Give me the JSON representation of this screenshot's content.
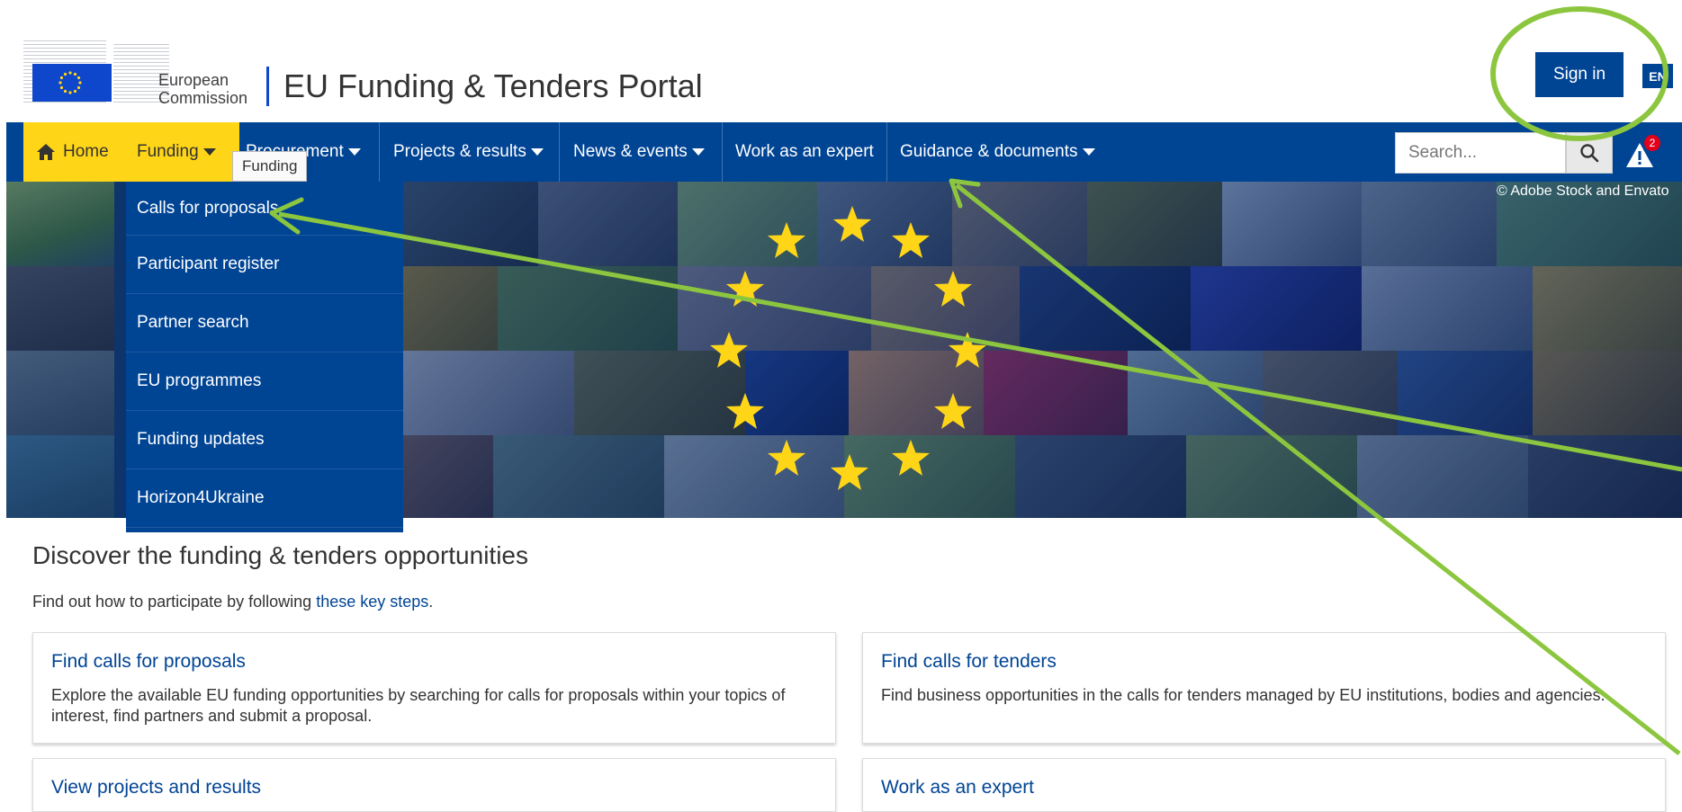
{
  "header": {
    "org_line1": "European",
    "org_line2": "Commission",
    "portal_title": "EU Funding & Tenders Portal",
    "sign_in": "Sign in",
    "language": "EN"
  },
  "nav": {
    "items": [
      {
        "label": "Home"
      },
      {
        "label": "Funding"
      },
      {
        "label": "Procurement"
      },
      {
        "label": "Projects & results"
      },
      {
        "label": "News & events"
      },
      {
        "label": "Work as an expert"
      },
      {
        "label": "Guidance & documents"
      }
    ],
    "search_placeholder": "Search...",
    "alert_count": "2",
    "tooltip": "Funding"
  },
  "dropdown": {
    "items": [
      "Calls for proposals",
      "Participant register",
      "Partner search",
      "EU programmes",
      "Funding updates",
      "Horizon4Ukraine"
    ]
  },
  "hero": {
    "copyright": "© Adobe Stock and Envato"
  },
  "main": {
    "title": "Discover the funding & tenders opportunities",
    "intro_prefix": "Find out how to participate by following ",
    "intro_link": "these key steps",
    "intro_suffix": ".",
    "cards": [
      {
        "title": "Find calls for proposals",
        "desc": "Explore the available EU funding opportunities by searching for calls for proposals within your topics of interest, find partners and submit a proposal."
      },
      {
        "title": "Find calls for tenders",
        "desc": "Find business opportunities in the calls for tenders managed by EU institutions, bodies and agencies."
      },
      {
        "title": "View projects and results",
        "desc": ""
      },
      {
        "title": "Work as an expert",
        "desc": ""
      }
    ]
  },
  "colors": {
    "brand_blue": "#004494",
    "accent_yellow": "#ffd617",
    "annotation_green": "#8cc63f",
    "alert_red": "#e3001b"
  }
}
